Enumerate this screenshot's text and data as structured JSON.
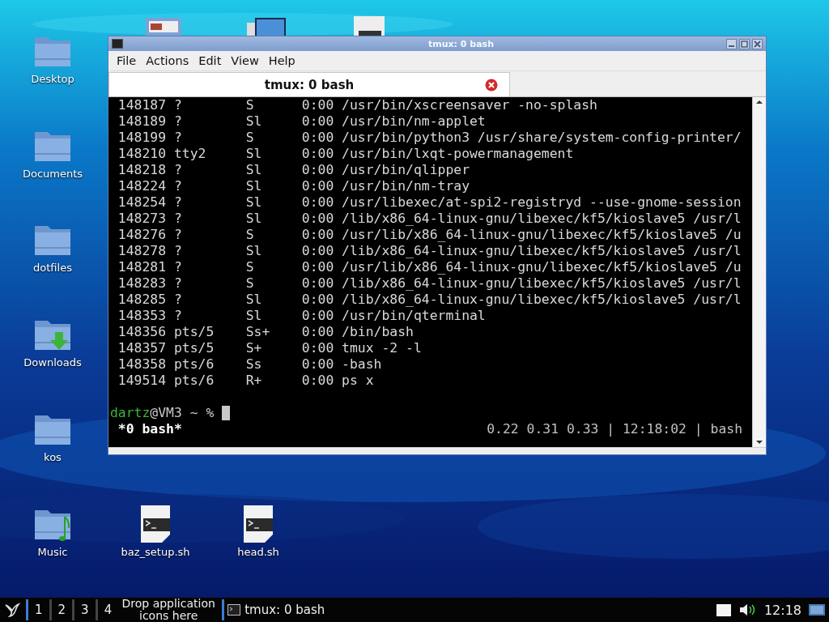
{
  "desktop_icons": [
    {
      "label": "Desktop",
      "kind": "folder"
    },
    {
      "label": "Documents",
      "kind": "folder"
    },
    {
      "label": "dotfiles",
      "kind": "folder"
    },
    {
      "label": "Downloads",
      "kind": "download-folder"
    },
    {
      "label": "kos",
      "kind": "folder"
    },
    {
      "label": "Music",
      "kind": "music-folder"
    },
    {
      "label": "baz_setup.sh",
      "kind": "script"
    },
    {
      "label": "head.sh",
      "kind": "script"
    }
  ],
  "window": {
    "title": "tmux: 0 bash",
    "menu": [
      "File",
      "Actions",
      "Edit",
      "View",
      "Help"
    ],
    "tabs": [
      {
        "label": "tmux: 0 bash",
        "selected": true
      }
    ],
    "terminal": {
      "rows": [
        {
          "pid": "148187",
          "tty": "?",
          "stat": "S",
          "time": "0:00",
          "command": "/usr/bin/xscreensaver -no-splash"
        },
        {
          "pid": "148189",
          "tty": "?",
          "stat": "Sl",
          "time": "0:00",
          "command": "/usr/bin/nm-applet"
        },
        {
          "pid": "148199",
          "tty": "?",
          "stat": "S",
          "time": "0:00",
          "command": "/usr/bin/python3 /usr/share/system-config-printer/"
        },
        {
          "pid": "148210",
          "tty": "tty2",
          "stat": "Sl",
          "time": "0:00",
          "command": "/usr/bin/lxqt-powermanagement"
        },
        {
          "pid": "148218",
          "tty": "?",
          "stat": "Sl",
          "time": "0:00",
          "command": "/usr/bin/qlipper"
        },
        {
          "pid": "148224",
          "tty": "?",
          "stat": "Sl",
          "time": "0:00",
          "command": "/usr/bin/nm-tray"
        },
        {
          "pid": "148254",
          "tty": "?",
          "stat": "Sl",
          "time": "0:00",
          "command": "/usr/libexec/at-spi2-registryd --use-gnome-session"
        },
        {
          "pid": "148273",
          "tty": "?",
          "stat": "Sl",
          "time": "0:00",
          "command": "/lib/x86_64-linux-gnu/libexec/kf5/kioslave5 /usr/l"
        },
        {
          "pid": "148276",
          "tty": "?",
          "stat": "S",
          "time": "0:00",
          "command": "/usr/lib/x86_64-linux-gnu/libexec/kf5/kioslave5 /u"
        },
        {
          "pid": "148278",
          "tty": "?",
          "stat": "Sl",
          "time": "0:00",
          "command": "/lib/x86_64-linux-gnu/libexec/kf5/kioslave5 /usr/l"
        },
        {
          "pid": "148281",
          "tty": "?",
          "stat": "S",
          "time": "0:00",
          "command": "/usr/lib/x86_64-linux-gnu/libexec/kf5/kioslave5 /u"
        },
        {
          "pid": "148283",
          "tty": "?",
          "stat": "S",
          "time": "0:00",
          "command": "/lib/x86_64-linux-gnu/libexec/kf5/kioslave5 /usr/l"
        },
        {
          "pid": "148285",
          "tty": "?",
          "stat": "Sl",
          "time": "0:00",
          "command": "/lib/x86_64-linux-gnu/libexec/kf5/kioslave5 /usr/l"
        },
        {
          "pid": "148353",
          "tty": "?",
          "stat": "Sl",
          "time": "0:00",
          "command": "/usr/bin/qterminal"
        },
        {
          "pid": "148356",
          "tty": "pts/5",
          "stat": "Ss+",
          "time": "0:00",
          "command": "/bin/bash"
        },
        {
          "pid": "148357",
          "tty": "pts/5",
          "stat": "S+",
          "time": "0:00",
          "command": "tmux -2 -l"
        },
        {
          "pid": "148358",
          "tty": "pts/6",
          "stat": "Ss",
          "time": "0:00",
          "command": "-bash"
        },
        {
          "pid": "149514",
          "tty": "pts/6",
          "stat": "R+",
          "time": "0:00",
          "command": "ps x"
        }
      ],
      "prompt_user": "dartz",
      "prompt_rest": "@VM3 ~ %",
      "status_left": "*0 bash*",
      "status_right": "0.22 0.31 0.33 | 12:18:02 | bash"
    }
  },
  "taskbar": {
    "desktops": [
      {
        "label": "1",
        "selected": true
      },
      {
        "label": "2",
        "selected": false
      },
      {
        "label": "3",
        "selected": false
      },
      {
        "label": "4",
        "selected": false
      }
    ],
    "quicklaunch": "Drop application icons here",
    "task": "tmux: 0 bash",
    "clock": "12:18"
  }
}
